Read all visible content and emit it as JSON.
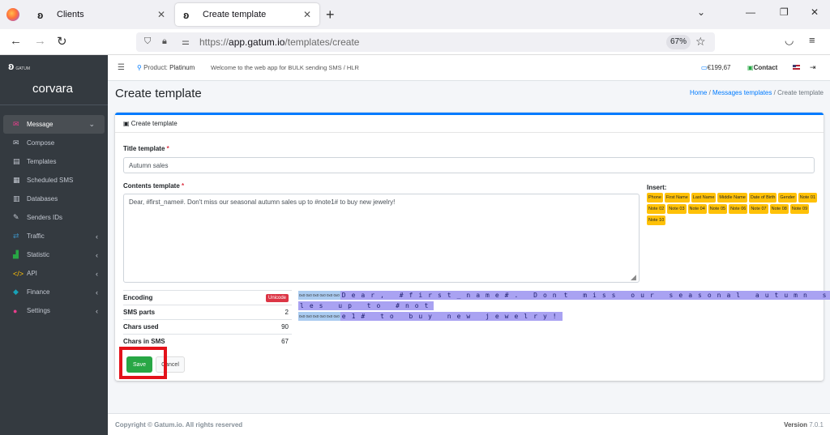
{
  "browser": {
    "tabs": [
      {
        "label": "Clients",
        "active": false
      },
      {
        "label": "Create template",
        "active": true
      }
    ],
    "url_prefix": "https://",
    "url_host": "app.gatum.io",
    "url_path": "/templates/create",
    "zoom": "67%"
  },
  "sidebar": {
    "brand_logo_text": "GATUM",
    "brand_name": "corvara",
    "items": [
      {
        "label": "Message",
        "icon": "message-icon",
        "color": "#e83e8c",
        "active": true,
        "chevron": "⌄"
      },
      {
        "label": "Compose",
        "icon": "envelope-icon",
        "color": "#c2c7d0"
      },
      {
        "label": "Templates",
        "icon": "file-icon",
        "color": "#c2c7d0"
      },
      {
        "label": "Scheduled SMS",
        "icon": "calendar-icon",
        "color": "#c2c7d0"
      },
      {
        "label": "Databases",
        "icon": "database-icon",
        "color": "#c2c7d0"
      },
      {
        "label": "Senders IDs",
        "icon": "feather-icon",
        "color": "#c2c7d0"
      },
      {
        "label": "Traffic",
        "icon": "handshake-icon",
        "color": "#3c8dbc",
        "chevron": "‹"
      },
      {
        "label": "Statistic",
        "icon": "chart-icon",
        "color": "#28a745",
        "chevron": "‹"
      },
      {
        "label": "API",
        "icon": "code-icon",
        "color": "#ffc107",
        "chevron": "‹"
      },
      {
        "label": "Finance",
        "icon": "finance-icon",
        "color": "#17a2b8",
        "chevron": "‹"
      },
      {
        "label": "Settings",
        "icon": "users-cog-icon",
        "color": "#e83e8c",
        "chevron": "‹"
      }
    ]
  },
  "header": {
    "product_label": "Product:",
    "product_value": "Platinum",
    "welcome": "Welcome to the web app for BULK sending SMS / HLR",
    "balance": "€199,67",
    "contact": "Contact"
  },
  "page": {
    "title": "Create template",
    "breadcrumb": {
      "home": "Home",
      "section": "Messages templates",
      "current": "Create template"
    }
  },
  "form": {
    "card_title": "Create template",
    "title_label": "Title template",
    "title_value": "Autumn sales",
    "content_label": "Contents template",
    "content_value": "Dear, #first_name#. Don't miss our seasonal autumn sales up to #note1# to buy new jewelry!",
    "insert_label": "Insert:",
    "insert_chips": [
      "Phone",
      "First Name",
      "Last Name",
      "Middle Name",
      "Date of Birth",
      "Gender",
      "Note 01",
      "Note 02",
      "Note 03",
      "Note 04",
      "Note 05",
      "Note 06",
      "Note 07",
      "Note 08",
      "Note 09",
      "Note 10"
    ],
    "stats": {
      "encoding_label": "Encoding",
      "encoding_value": "Unicode",
      "sms_parts_label": "SMS parts",
      "sms_parts_value": "2",
      "chars_used_label": "Chars used",
      "chars_used_value": "90",
      "chars_in_sms_label": "Chars in SMS",
      "chars_in_sms_value": "67"
    },
    "charmap": {
      "row1_codes": "0x0 0x0 0x0 0x0 0x0 0x0",
      "row1_text_a": "Dear, #first_name#. Don",
      "row1_text_b": "t miss our seasonal autumn sa",
      "row2_text": "les up to #not",
      "row3_codes": "0x0 0x0 0x0 0x0 0x0 0x0",
      "row3_text": "e1# to buy new jewelry!"
    },
    "save_label": "Save",
    "cancel_label": "Cancel"
  },
  "footer": {
    "copyright": "Copyright © Gatum.io. All rights reserved",
    "version_label": "Version",
    "version_value": "7.0.1"
  },
  "colors": {
    "accent": "#007bff",
    "save": "#28a745",
    "chip": "#ffc107",
    "highlight": "#e3121a"
  }
}
